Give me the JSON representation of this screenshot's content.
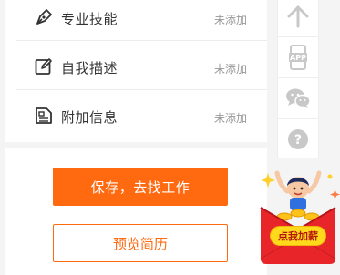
{
  "sections": [
    {
      "label": "专业技能",
      "status": "未添加",
      "icon": "pen-tip-icon"
    },
    {
      "label": "自我描述",
      "status": "未添加",
      "icon": "edit-box-icon"
    },
    {
      "label": "附加信息",
      "status": "未添加",
      "icon": "document-info-icon"
    }
  ],
  "actions": {
    "save_label": "保存，去找工作",
    "preview_label": "预览简历"
  },
  "toolbar": {
    "items": [
      {
        "icon": "arrow-up-icon"
      },
      {
        "icon": "mobile-app-icon",
        "label": "APP"
      },
      {
        "icon": "wechat-icon"
      },
      {
        "icon": "help-icon",
        "label": "?"
      }
    ]
  },
  "promo": {
    "label": "点我加薪"
  },
  "colors": {
    "accent": "#ff6a10",
    "icon_gray": "#c8c8c8",
    "text": "#333333",
    "muted": "#999999"
  }
}
